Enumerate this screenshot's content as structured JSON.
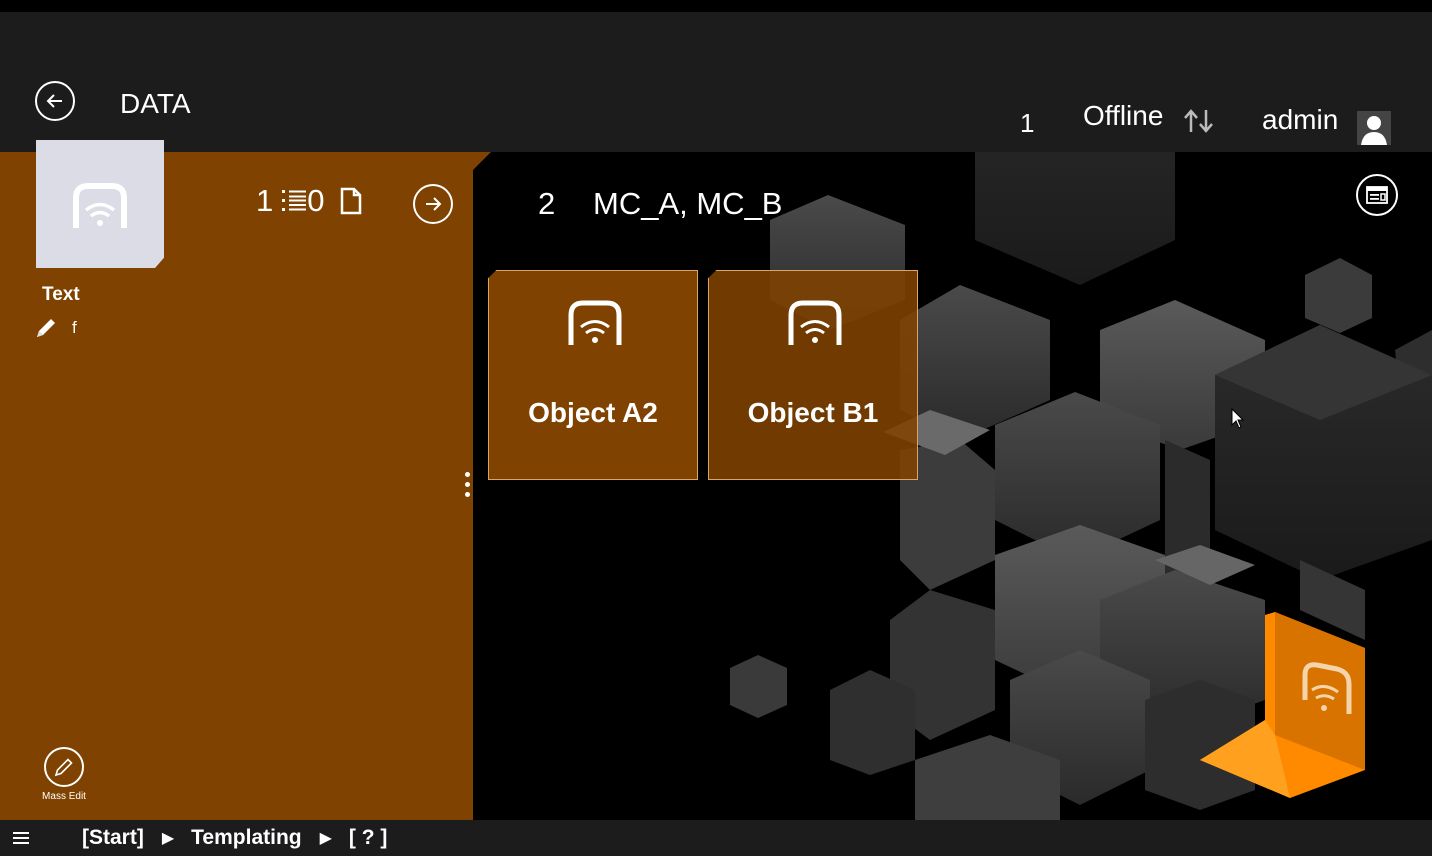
{
  "header": {
    "title": "DATA",
    "count": "1",
    "status": "Offline",
    "user": "admin"
  },
  "left_panel": {
    "object_label": "Text",
    "edit_value": "f",
    "stats": {
      "items": "1",
      "documents": "0"
    },
    "mass_edit_label": "Mass Edit"
  },
  "main": {
    "group_count": "2",
    "group_name": "MC_A, MC_B",
    "tiles": [
      {
        "name": "Object A2"
      },
      {
        "name": "Object B1"
      }
    ]
  },
  "statusbar": {
    "breadcrumbs": [
      "[Start]",
      "Templating",
      "[ ? ]"
    ]
  },
  "colors": {
    "panel": "#7f4200",
    "header": "#1c1c1c",
    "accent_cube": "#ff8a00",
    "thumb": "#dcdce6"
  },
  "icons": {
    "back": "arrow-left-circle-icon",
    "go": "arrow-right-circle-icon",
    "sync": "sync-arrows-icon",
    "avatar": "user-icon",
    "object": "wifi-tag-icon",
    "list": "list-icon",
    "document": "document-icon",
    "pencil": "pencil-icon",
    "view": "card-view-icon",
    "menu": "hamburger-icon"
  }
}
